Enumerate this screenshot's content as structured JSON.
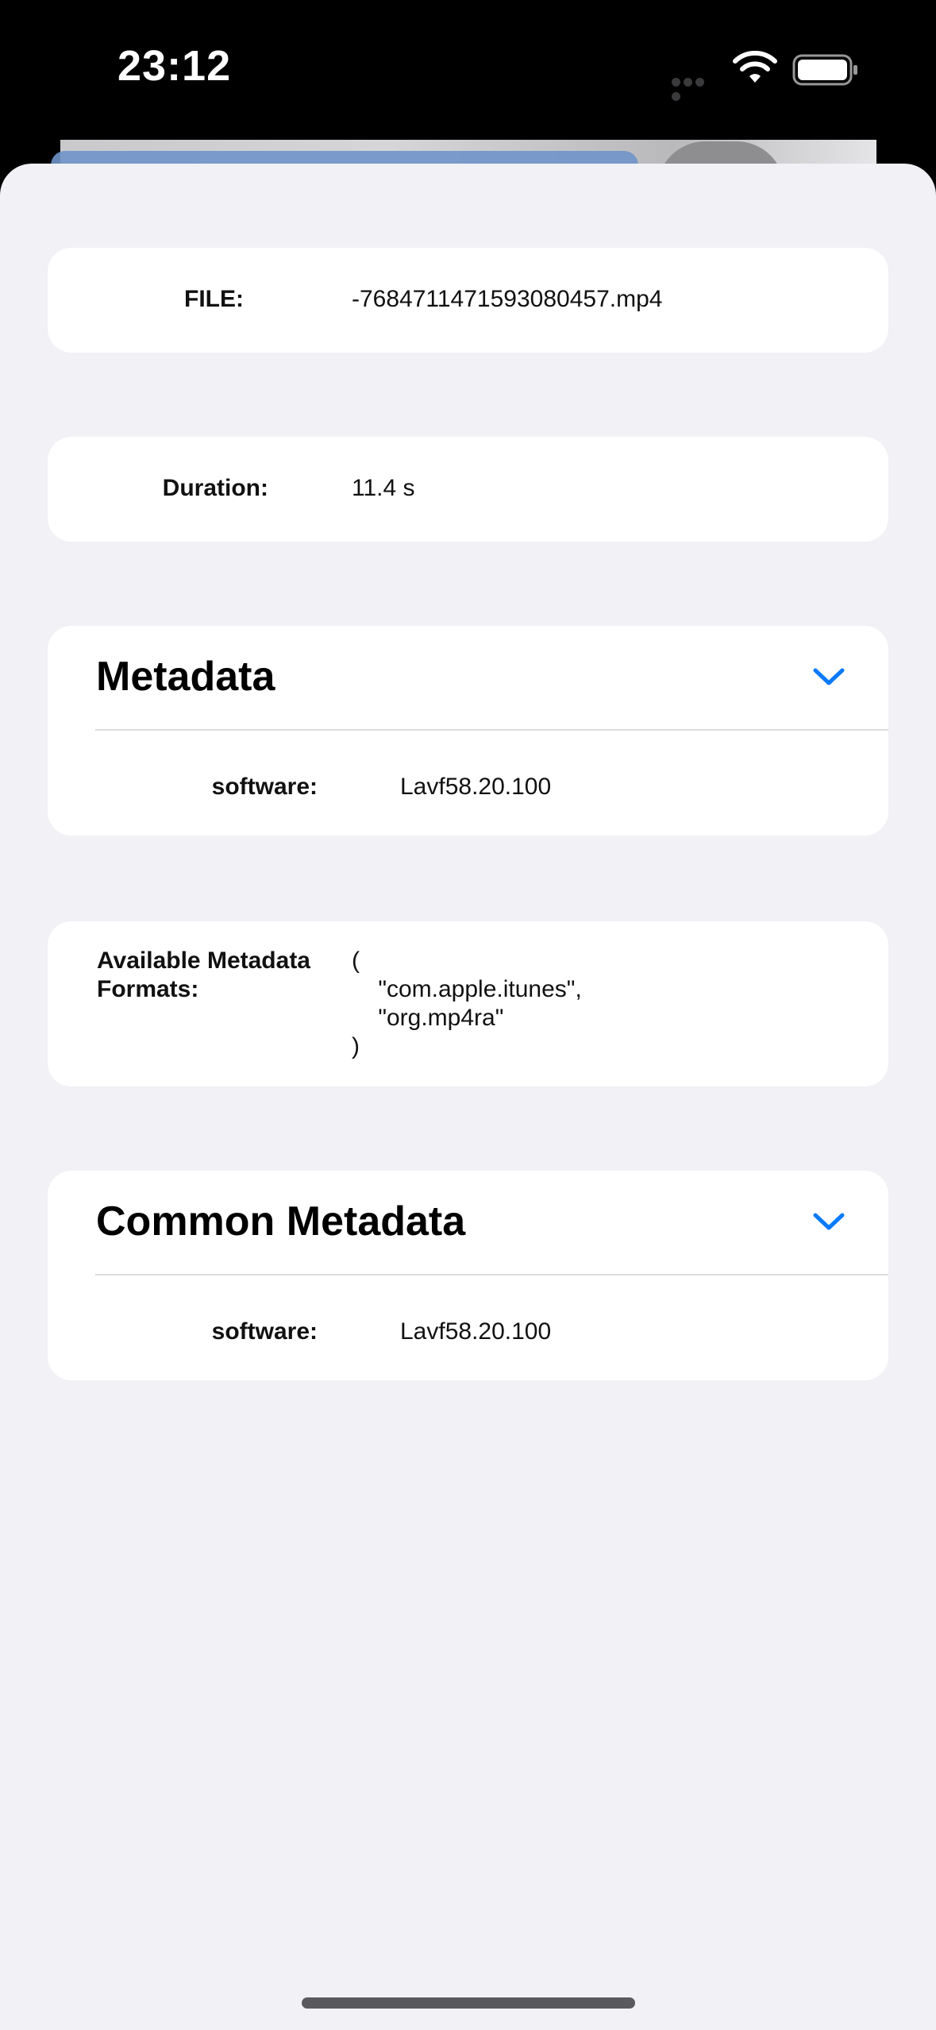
{
  "status_bar": {
    "time": "23:12"
  },
  "file_card": {
    "label": "FILE:",
    "value": "-7684711471593080457.mp4"
  },
  "duration_card": {
    "label": "Duration:",
    "value": "11.4 s"
  },
  "metadata_section": {
    "title": "Metadata",
    "rows": [
      {
        "label": "software:",
        "value": "Lavf58.20.100"
      }
    ]
  },
  "formats_card": {
    "label": "Available Metadata Formats:",
    "value": "(\n    \"com.apple.itunes\",\n    \"org.mp4ra\"\n)"
  },
  "common_metadata_section": {
    "title": "Common Metadata",
    "rows": [
      {
        "label": "software:",
        "value": "Lavf58.20.100"
      }
    ]
  },
  "colors": {
    "accent": "#0a7aff",
    "sheet_bg": "#f1f1f6",
    "card_bg": "#ffffff"
  },
  "icons": {
    "chevron": "chevron-down-icon",
    "wifi": "wifi-icon",
    "battery": "battery-icon"
  }
}
